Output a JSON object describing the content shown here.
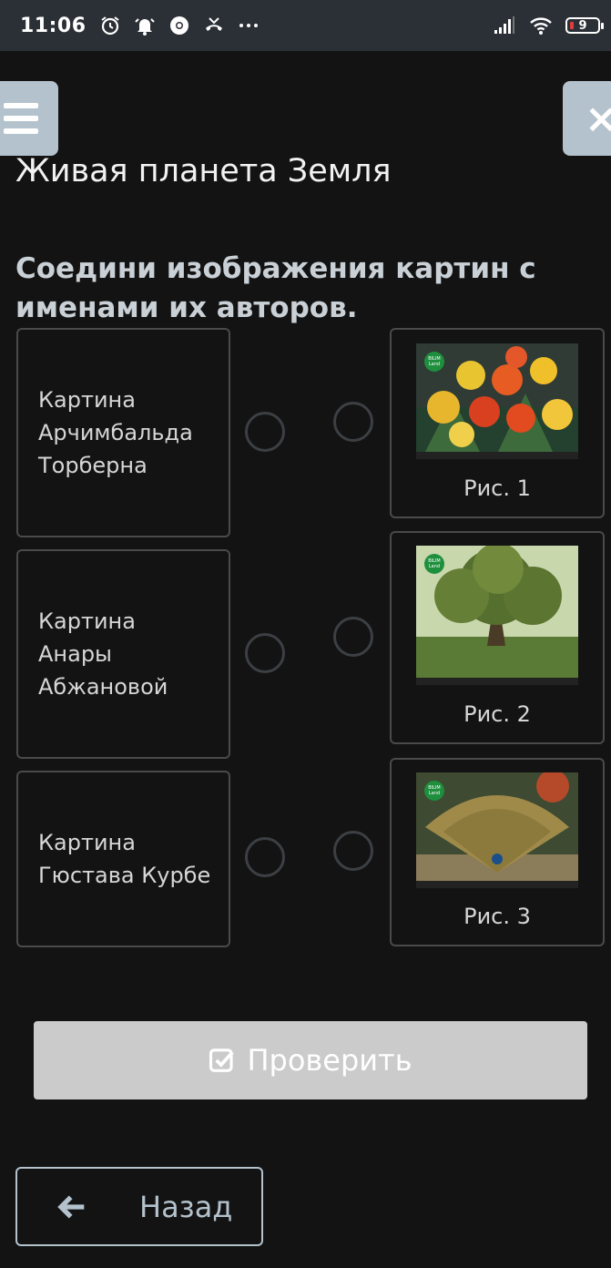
{
  "status_bar": {
    "time": "11:06",
    "battery": "9",
    "icons_left": [
      "alarm-icon",
      "notification-bell-icon",
      "chrome-icon",
      "missed-call-icon",
      "more-dots-icon"
    ],
    "icons_right": [
      "signal-icon",
      "wifi-icon",
      "battery-icon"
    ]
  },
  "header": {
    "menu_icon": "hamburger-icon",
    "close_label": "×",
    "title": "Живая планета Земля"
  },
  "question": "Соедини изображения картин с именами их авторов.",
  "left_items": [
    {
      "label": "Картина Арчимбальда Торберна"
    },
    {
      "label": "Картина Анары Абжановой"
    },
    {
      "label": "Картина Гюстава Курбе"
    }
  ],
  "right_items": [
    {
      "caption": "Рис. 1",
      "image": "flowers-painting"
    },
    {
      "caption": "Рис. 2",
      "image": "oak-tree-painting"
    },
    {
      "caption": "Рис. 3",
      "image": "peacock-painting"
    }
  ],
  "watermark": "BILIM Land",
  "actions": {
    "check_label": "Проверить",
    "back_label": "Назад"
  },
  "colors": {
    "background": "#131313",
    "status_bar": "#2b2f36",
    "accent": "#b3c2cc",
    "check_button": "#cbcbcb"
  }
}
